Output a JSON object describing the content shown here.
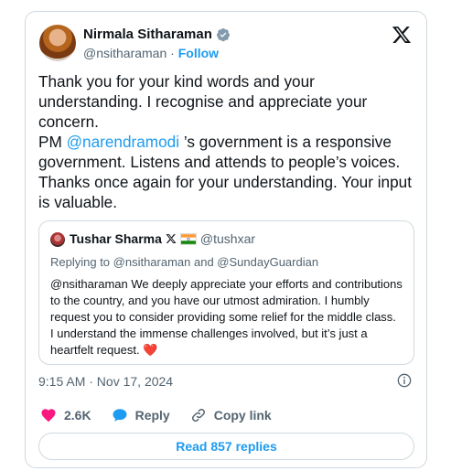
{
  "tweet": {
    "author_name": "Nirmala Sitharaman",
    "author_handle": "@nsitharaman",
    "separator": " · ",
    "follow_label": "Follow",
    "text_p1": "Thank you for your kind words and your understanding. I recognise and appreciate your concern.",
    "text_p2_prefix": "PM ",
    "text_p2_mention": "@narendramodi",
    "text_p2_suffix": " ’s government is a responsive government. Listens and attends to people’s voices. Thanks once again for your understanding. Your input is valuable.",
    "timestamp": "9:15 AM · Nov 17, 2024"
  },
  "quote": {
    "author_name": "Tushar Sharma",
    "author_handle": "@tushxar",
    "replying_to": "Replying to @nsitharaman and @SundayGuardian",
    "text": "@nsitharaman We deeply appreciate your efforts and contributions to the country, and you have our utmost admiration. I humbly request you to consider providing some relief for the middle class. I understand the immense challenges involved, but it’s just a heartfelt request. ",
    "emoji": "❤️"
  },
  "actions": {
    "likes": "2.6K",
    "reply_label": "Reply",
    "copy_link_label": "Copy link"
  },
  "footer": {
    "read_replies_label": "Read 857 replies"
  },
  "colors": {
    "accent": "#1d9bf0",
    "like": "#f91880",
    "muted": "#536471"
  }
}
